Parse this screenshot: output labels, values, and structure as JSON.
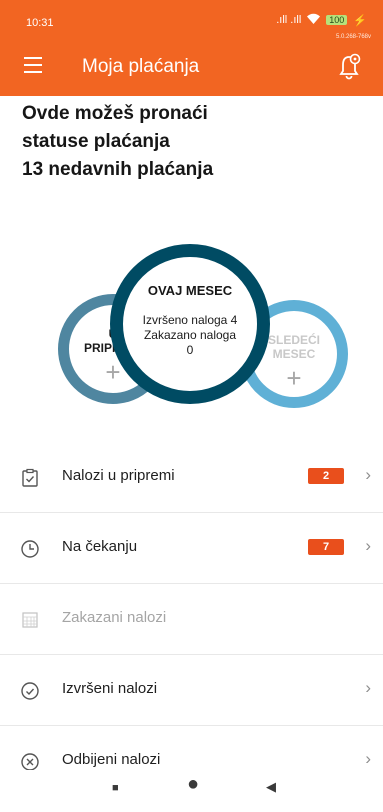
{
  "status_bar": {
    "time": "10:31",
    "signal": ".ıll .ıll",
    "wifi_icon": "wifi-icon",
    "battery": "100",
    "version": "5.0.268-768v"
  },
  "app_bar": {
    "title": "Moja plaćanja",
    "menu_icon": "menu-icon",
    "bell_icon": "notification-settings-icon"
  },
  "headline": {
    "line1": "Ovde možeš pronaći",
    "line2": "statuse plaćanja",
    "line3": "13 nedavnih plaćanja"
  },
  "circles": {
    "left": {
      "title_line1": "U",
      "title_line2": "PRIPREMI",
      "plus": "+"
    },
    "center": {
      "title": "OVAJ MESEC",
      "line1": "Izvršeno naloga 4",
      "line2": "Zakazano naloga",
      "line3": "0"
    },
    "right": {
      "title_line1": "SLEDEĆI",
      "title_line2": "MESEC",
      "plus": "+"
    }
  },
  "list": [
    {
      "label": "Nalozi u pripremi",
      "badge": "2",
      "icon": "clipboard-check-icon",
      "chevron": "›"
    },
    {
      "label": "Na čekanju",
      "badge": "7",
      "icon": "clock-icon",
      "chevron": "›"
    },
    {
      "label": "Zakazani nalozi",
      "icon": "calendar-icon"
    },
    {
      "label": "Izvršeni nalozi",
      "icon": "check-circle-icon",
      "chevron": "›"
    },
    {
      "label": "Odbijeni nalozi",
      "icon": "x-circle-icon",
      "chevron": "›"
    }
  ],
  "nav": {
    "recents": "■",
    "home": "●",
    "back": "◀"
  },
  "colors": {
    "accent": "#f26522",
    "dark_teal": "#004b63",
    "steel_blue": "#4f86a0",
    "sky_blue": "#5fb0d6",
    "badge": "#e94f1c"
  }
}
